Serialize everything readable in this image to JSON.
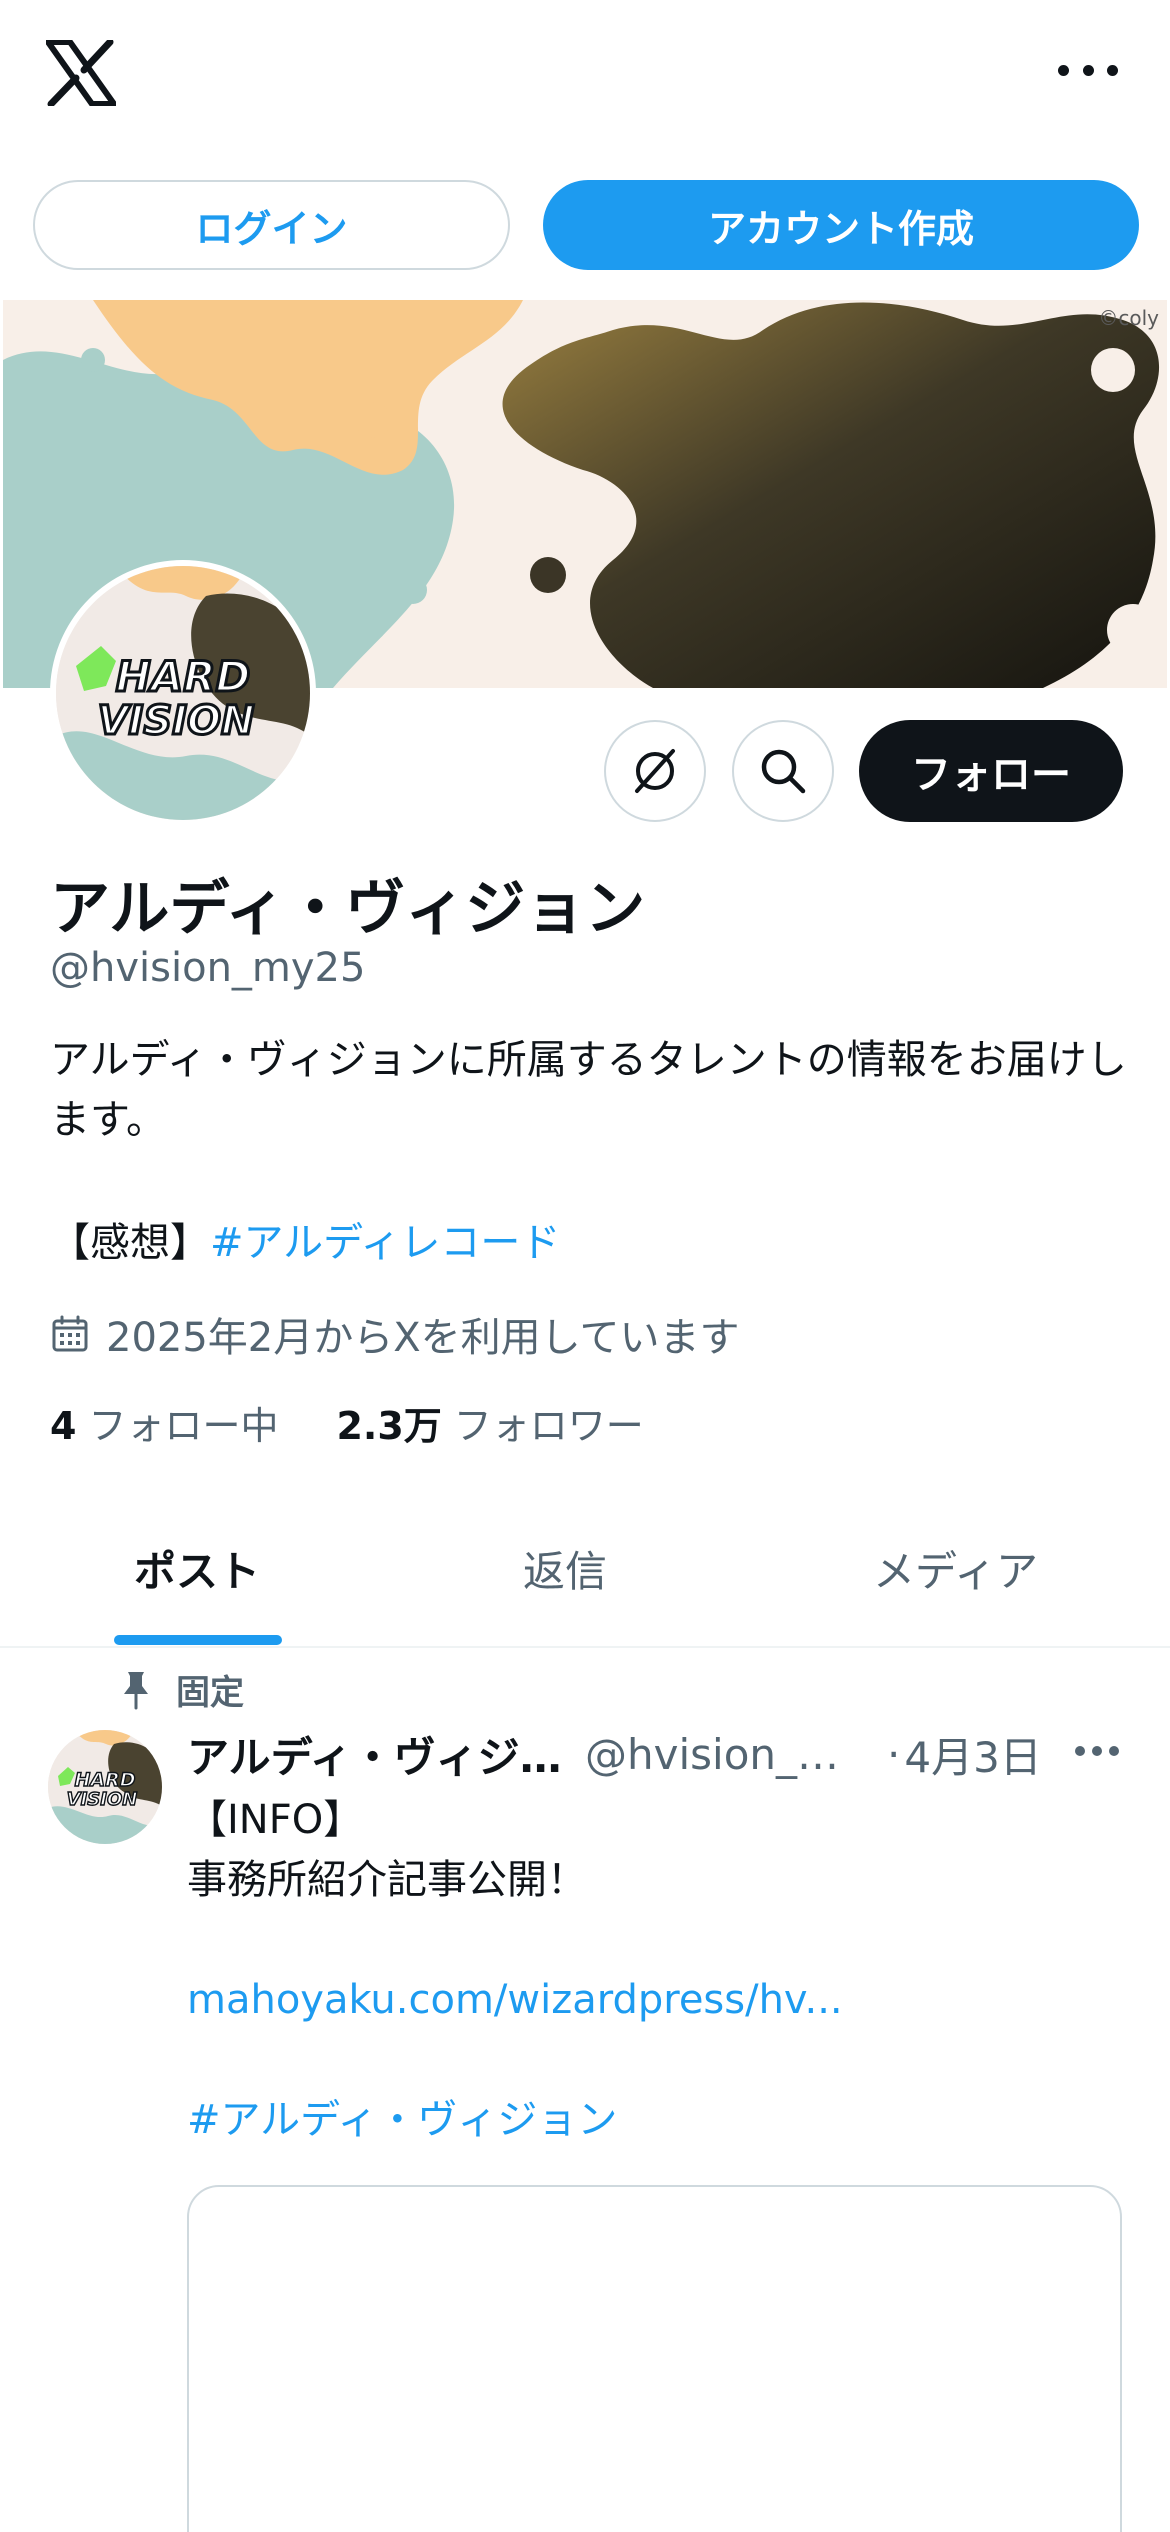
{
  "topbar": {
    "logo_icon": "x-logo-icon",
    "more_icon": "more-horizontal-icon"
  },
  "auth": {
    "login_label": "ログイン",
    "signup_label": "アカウント作成"
  },
  "banner": {
    "credit": "©coly"
  },
  "avatar": {
    "logo_text_1": "HARD",
    "logo_text_2": "VISION"
  },
  "profile_actions": {
    "grok_icon": "grok-icon",
    "search_icon": "search-icon",
    "follow_label": "フォロー"
  },
  "profile": {
    "display_name": "アルディ・ヴィジョン",
    "handle": "@hvision_my25",
    "bio": "アルディ・ヴィジョンに所属するタレントの情報をお届けします。",
    "bio_label": "【感想】",
    "bio_hashtag": "#アルディレコード",
    "joined": "2025年2月からXを利用しています",
    "following_count": "4",
    "following_label": "フォロー中",
    "followers_count": "2.3万",
    "followers_label": "フォロワー"
  },
  "tabs": [
    {
      "label": "ポスト",
      "active": true
    },
    {
      "label": "返信",
      "active": false
    },
    {
      "label": "メディア",
      "active": false
    }
  ],
  "post": {
    "pinned_label": "固定",
    "author": "アルディ・ヴィジ...",
    "handle": "@hvision_m...",
    "separator": "·",
    "date": "4月3日",
    "line1": "【INFO】",
    "line2": "事務所紹介記事公開！",
    "link": "mahoyaku.com/wizardpress/hv...",
    "hashtag": "#アルディ・ヴィジョン"
  },
  "colors": {
    "accent": "#1d9bf0",
    "text_primary": "#0f1419",
    "text_secondary": "#536471",
    "border": "#cfd9de"
  }
}
